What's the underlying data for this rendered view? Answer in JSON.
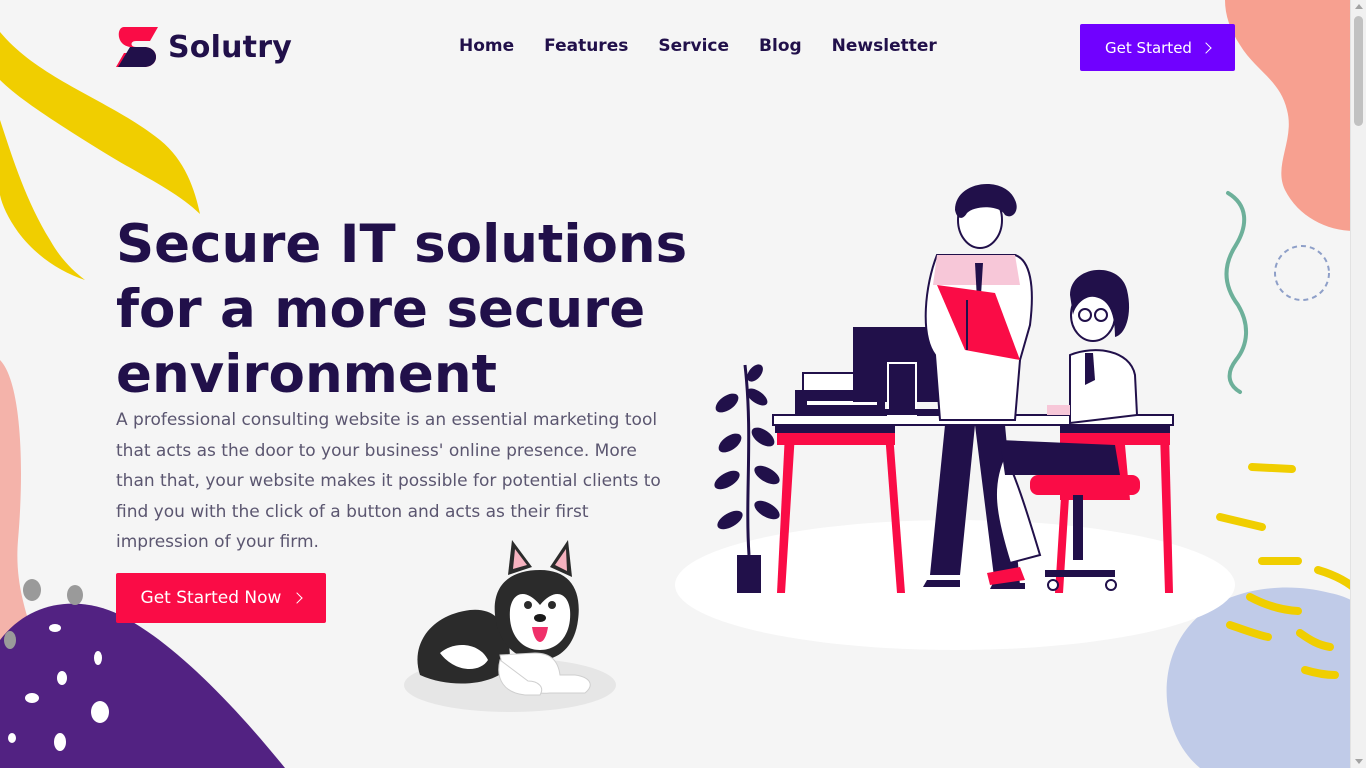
{
  "brand": {
    "name": "Solutry"
  },
  "nav": {
    "items": [
      {
        "label": "Home"
      },
      {
        "label": "Features"
      },
      {
        "label": "Service"
      },
      {
        "label": "Blog"
      },
      {
        "label": "Newsletter"
      }
    ]
  },
  "header": {
    "cta_label": "Get Started"
  },
  "hero": {
    "title": "Secure IT solutions for a more secure environment",
    "description": "A professional consulting website is an essential marketing tool that acts as the door to your business' online presence. More than that, your website makes it possible for potential clients to find you with the click of a button and acts as their first impression of your firm.",
    "cta_label": "Get Started Now"
  },
  "colors": {
    "primary": "#7001ff",
    "accent": "#fa0c46",
    "heading": "#21104a",
    "body_text": "#5b5670",
    "background": "#f5f5f5",
    "yellow": "#f0ce00",
    "coral": "#f7a090",
    "purple_blob": "#522282",
    "lavender": "#c0cbe8",
    "green": "#6db09a"
  },
  "icons": {
    "logo": "solutry-s-logo-icon",
    "chevron": "chevron-right-icon"
  }
}
